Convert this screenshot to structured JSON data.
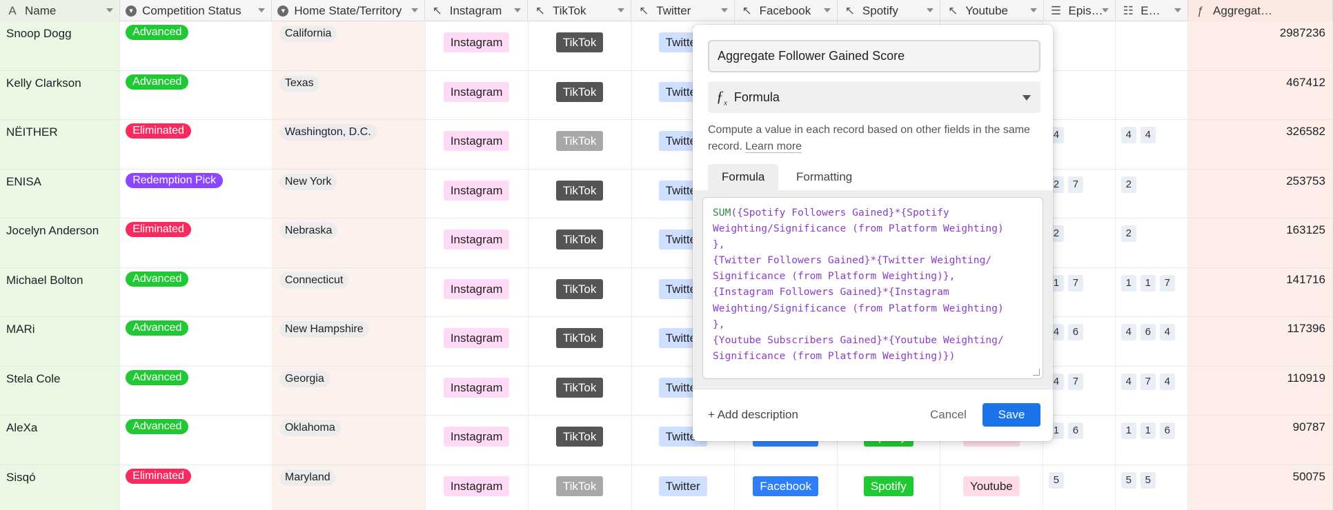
{
  "columns": [
    {
      "label": "Name",
      "icon": "text-icon"
    },
    {
      "label": "Competition Status",
      "icon": "single-select-icon"
    },
    {
      "label": "Home State/Territory",
      "icon": "single-select-icon"
    },
    {
      "label": "Instagram",
      "icon": "button-field-icon"
    },
    {
      "label": "TikTok",
      "icon": "button-field-icon"
    },
    {
      "label": "Twitter",
      "icon": "button-field-icon"
    },
    {
      "label": "Facebook",
      "icon": "button-field-icon"
    },
    {
      "label": "Spotify",
      "icon": "button-field-icon"
    },
    {
      "label": "Youtube",
      "icon": "button-field-icon"
    },
    {
      "label": "Epis…",
      "icon": "lookup-icon"
    },
    {
      "label": "E…",
      "icon": "rollup-icon"
    },
    {
      "label": "Aggregat…",
      "icon": "formula-icon"
    }
  ],
  "buttons": {
    "instagram": "Instagram",
    "tiktok": "TikTok",
    "twitter": "Twitter",
    "facebook": "Facebook",
    "spotify": "Spotify",
    "youtube": "Youtube"
  },
  "colors": {
    "advanced": "#20c933",
    "eliminated": "#f82b60",
    "redemption": "#8b46ff",
    "instagram_bg": "#ffdaf6",
    "tiktok_bg": "#555555",
    "tiktok_disabled_bg": "#a8a8a8",
    "twitter_bg": "#cfdfff",
    "facebook_bg": "#2d7ff9",
    "spotify_bg": "#20c933",
    "youtube_bg": "#ffdce5",
    "save_button": "#1a73e8"
  },
  "records": [
    {
      "name": "Snoop Dogg",
      "status": "Advanced",
      "status_kind": "advanced",
      "state": "California",
      "tiktok_disabled": false,
      "episodes": [],
      "episode_rollup": [],
      "aggregate": "2987236"
    },
    {
      "name": "Kelly Clarkson",
      "status": "Advanced",
      "status_kind": "advanced",
      "state": "Texas",
      "tiktok_disabled": false,
      "episodes": [],
      "episode_rollup": [],
      "aggregate": "467412"
    },
    {
      "name": "NËITHER",
      "status": "Eliminated",
      "status_kind": "eliminated",
      "state": "Washington, D.C.",
      "tiktok_disabled": true,
      "episodes": [
        "4"
      ],
      "episode_rollup": [
        "4",
        "4"
      ],
      "aggregate": "326582"
    },
    {
      "name": "ENISA",
      "status": "Redemption Pick",
      "status_kind": "redemption",
      "state": "New York",
      "tiktok_disabled": false,
      "episodes": [
        "2",
        "7"
      ],
      "episode_rollup": [
        "2"
      ],
      "aggregate": "253753"
    },
    {
      "name": "Jocelyn Anderson",
      "status": "Eliminated",
      "status_kind": "eliminated",
      "state": "Nebraska",
      "tiktok_disabled": false,
      "episodes": [
        "2"
      ],
      "episode_rollup": [
        "2"
      ],
      "aggregate": "163125"
    },
    {
      "name": "Michael Bolton",
      "status": "Advanced",
      "status_kind": "advanced",
      "state": "Connecticut",
      "tiktok_disabled": false,
      "episodes": [
        "1",
        "7"
      ],
      "episode_rollup": [
        "1",
        "1",
        "7"
      ],
      "aggregate": "141716"
    },
    {
      "name": "MARi",
      "status": "Advanced",
      "status_kind": "advanced",
      "state": "New Hampshire",
      "tiktok_disabled": false,
      "episodes": [
        "4",
        "6"
      ],
      "episode_rollup": [
        "4",
        "6",
        "4"
      ],
      "aggregate": "117396"
    },
    {
      "name": "Stela Cole",
      "status": "Advanced",
      "status_kind": "advanced",
      "state": "Georgia",
      "tiktok_disabled": false,
      "episodes": [
        "4",
        "7"
      ],
      "episode_rollup": [
        "4",
        "7",
        "4"
      ],
      "aggregate": "110919"
    },
    {
      "name": "AleXa",
      "status": "Advanced",
      "status_kind": "advanced",
      "state": "Oklahoma",
      "tiktok_disabled": false,
      "episodes": [
        "1",
        "6"
      ],
      "episode_rollup": [
        "1",
        "1",
        "6"
      ],
      "aggregate": "90787"
    },
    {
      "name": "Sisqó",
      "status": "Eliminated",
      "status_kind": "eliminated",
      "state": "Maryland",
      "tiktok_disabled": true,
      "episodes": [
        "5"
      ],
      "episode_rollup": [
        "5",
        "5"
      ],
      "aggregate": "50075"
    }
  ],
  "dialog": {
    "field_name": "Aggregate Follower Gained Score",
    "field_type": "Formula",
    "description_text": "Compute a value in each record based on other fields in the same record.",
    "learn_more": "Learn more",
    "tabs": [
      "Formula",
      "Formatting"
    ],
    "formula_function": "SUM",
    "formula_lines": [
      "({Spotify Followers Gained}*{Spotify",
      "Weighting/Significance (from Platform Weighting)",
      "},",
      "{Twitter Followers Gained}*{Twitter Weighting/",
      "Significance (from Platform Weighting)},",
      "{Instagram Followers Gained}*{Instagram",
      "Weighting/Significance (from Platform Weighting)",
      "},",
      "{Youtube Subscribers Gained}*{Youtube Weighting/",
      "Significance (from Platform Weighting)})"
    ],
    "add_description": "+ Add description",
    "cancel": "Cancel",
    "save": "Save"
  }
}
